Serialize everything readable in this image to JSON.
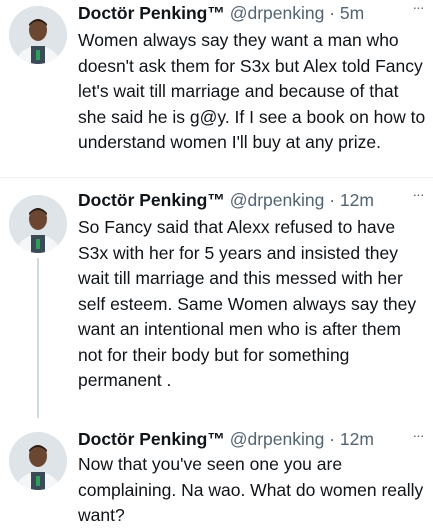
{
  "tweets": [
    {
      "display_name": "Doctör Penking™",
      "handle": "@drpenking",
      "separator": "·",
      "time": "5m",
      "text": "Women always say they want a man who doesn't ask them for S3x but Alex told Fancy let's wait till marriage and because of that she said he is g@y. If I see a book on how to understand women I'll buy at any prize.",
      "more_icon": "···"
    },
    {
      "display_name": "Doctör Penking™",
      "handle": "@drpenking",
      "separator": "·",
      "time": "12m",
      "text": "So Fancy said that Alexx refused to have S3x with her for 5 years and insisted they wait till marriage and this messed with her self esteem. Same Women always say they want an intentional men who is after them not for their body but for something permanent .",
      "more_icon": "···"
    },
    {
      "display_name": "Doctör Penking™",
      "handle": "@drpenking",
      "separator": "·",
      "time": "12m",
      "text": "Now that you've seen one you are complaining. Na wao. What do women really want?",
      "more_icon": "···"
    }
  ]
}
